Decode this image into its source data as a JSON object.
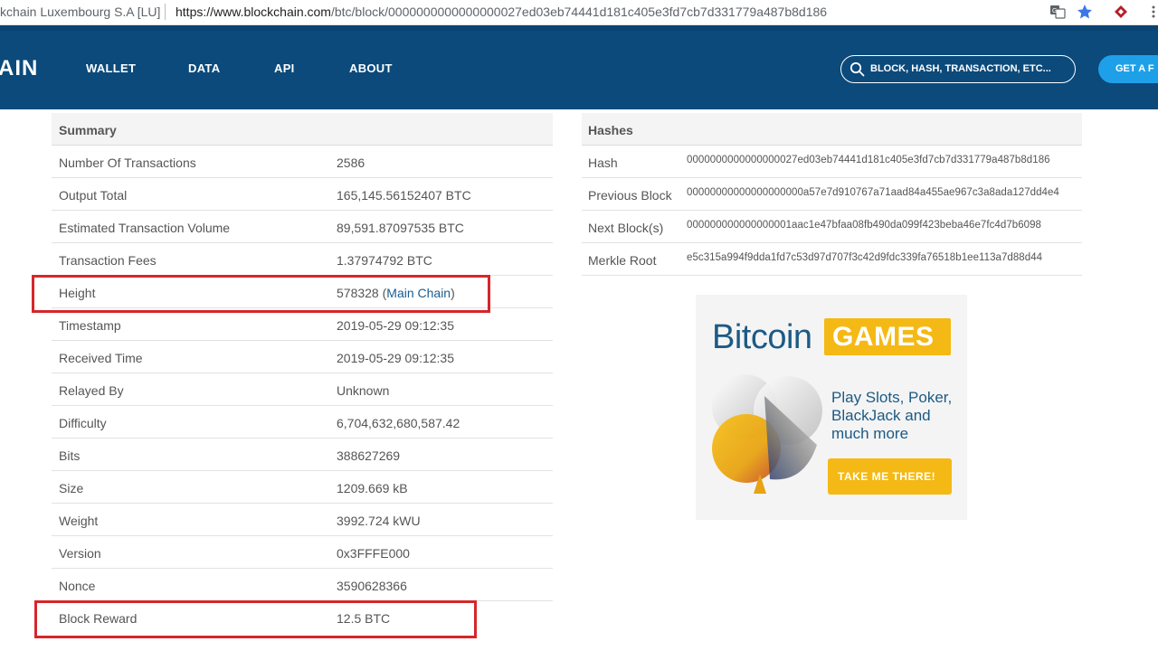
{
  "browser": {
    "site_label": "kchain Luxembourg S.A [LU]",
    "url_domain": "https://www.blockchain.com",
    "url_path": "/btc/block/0000000000000000027ed03eb74441d181c405e3fd7cb7d331779a487b8d186",
    "icons": [
      "translate-icon",
      "star-icon",
      "extension-icon"
    ]
  },
  "header": {
    "logo": "AIN",
    "nav": [
      "WALLET",
      "DATA",
      "API",
      "ABOUT"
    ],
    "search_placeholder": "BLOCK, HASH, TRANSACTION, ETC...",
    "cta": "GET A F",
    "colors": {
      "header": "#0b4a7b",
      "cta": "#1ea0e8"
    }
  },
  "summary": {
    "title": "Summary",
    "rows": [
      {
        "label": "Number Of Transactions",
        "value": "2586"
      },
      {
        "label": "Output Total",
        "value": "165,145.56152407 BTC"
      },
      {
        "label": "Estimated Transaction Volume",
        "value": "89,591.87097535 BTC"
      },
      {
        "label": "Transaction Fees",
        "value": "1.37974792 BTC"
      },
      {
        "label": "Height",
        "value": "578328 (",
        "link": "Main Chain",
        "suffix": ")"
      },
      {
        "label": "Timestamp",
        "value": "2019-05-29 09:12:35"
      },
      {
        "label": "Received Time",
        "value": "2019-05-29 09:12:35"
      },
      {
        "label": "Relayed By",
        "value": "Unknown"
      },
      {
        "label": "Difficulty",
        "value": "6,704,632,680,587.42"
      },
      {
        "label": "Bits",
        "value": "388627269"
      },
      {
        "label": "Size",
        "value": "1209.669 kB"
      },
      {
        "label": "Weight",
        "value": "3992.724 kWU"
      },
      {
        "label": "Version",
        "value": "0x3FFFE000"
      },
      {
        "label": "Nonce",
        "value": "3590628366"
      },
      {
        "label": "Block Reward",
        "value": "12.5 BTC"
      }
    ]
  },
  "hashes": {
    "title": "Hashes",
    "rows": [
      {
        "label": "Hash",
        "value": "0000000000000000027ed03eb74441d181c405e3fd7cb7d331779a487b8d186"
      },
      {
        "label": "Previous Block",
        "value": "00000000000000000000a57e7d910767a71aad84a455ae967c3a8ada127dd4e4"
      },
      {
        "label": "Next Block(s)",
        "value": "000000000000000001aac1e47bfaa08fb490da099f423beba46e7fc4d7b6098"
      },
      {
        "label": "Merkle Root",
        "value": "e5c315a994f9dda1fd7c53d97d707f3c42d9fdc339fa76518b1ee113a7d88d44"
      }
    ]
  },
  "ad": {
    "brand": "Bitcoin",
    "brand_badge": "GAMES",
    "tagline": "Play Slots, Poker, BlackJack and much more",
    "button": "TAKE ME THERE!",
    "colors": {
      "blue": "#1d5a84",
      "yellow": "#f5b915"
    }
  },
  "highlight_color": "#d6262b"
}
